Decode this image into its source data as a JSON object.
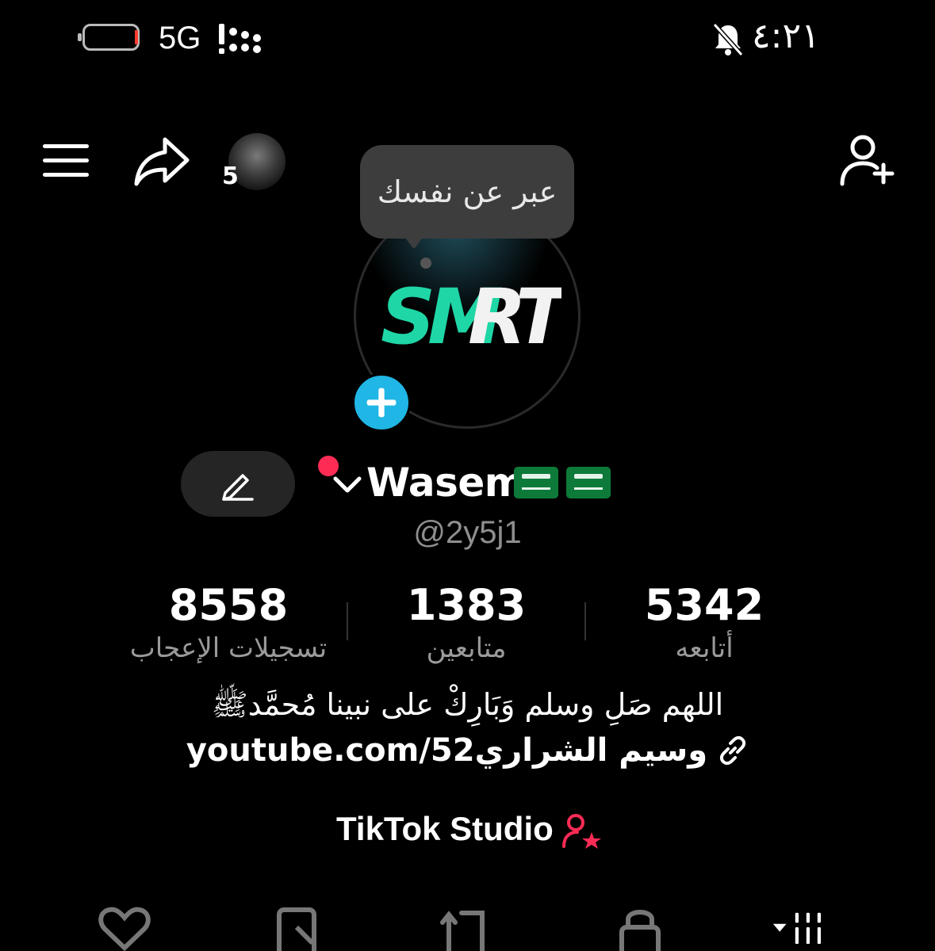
{
  "status_bar": {
    "network": "5G",
    "time": "٤:٢١"
  },
  "top_bar": {
    "story_count": "5"
  },
  "tooltip": {
    "text": "عبر عن نفسك"
  },
  "avatar": {
    "logo_text_teal": "SM",
    "logo_text_white": "RT"
  },
  "profile": {
    "display_name": "Wasem",
    "username": "@2y5j1"
  },
  "stats": [
    {
      "value": "5342",
      "label": "أتابعه"
    },
    {
      "value": "1383",
      "label": "متابعين"
    },
    {
      "value": "8558",
      "label": "تسجيلات الإعجاب"
    }
  ],
  "bio": {
    "line": "اللهم صَلِ وسلم وَبَارِكْ على نبينا مُحمَّدﷺ",
    "link": "وسيم الشراريyoutube.com/52"
  },
  "studio": {
    "label": "TikTok Studio"
  },
  "colors": {
    "accent_pink": "#fe2c55",
    "accent_blue": "#20b6e6",
    "logo_teal": "#1fd6a6"
  }
}
